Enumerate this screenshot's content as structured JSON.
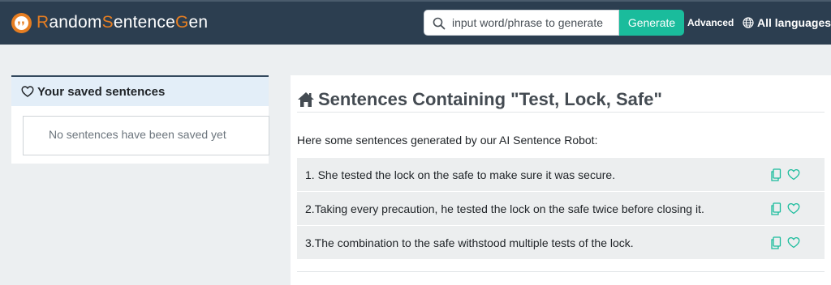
{
  "header": {
    "logo_parts": [
      "R",
      "andom",
      "S",
      "entence",
      "G",
      "en"
    ],
    "search_placeholder": "input word/phrase to generate",
    "generate_label": "Generate",
    "advanced_label": "Advanced",
    "languages_label": "All languages",
    "icons": [
      "logo-icon",
      "search-icon",
      "globe-icon"
    ]
  },
  "saved": {
    "title": "Your saved sentences",
    "empty_text": "No sentences have been saved yet",
    "icon": "heart-icon"
  },
  "main": {
    "title": "Sentences Containing \"Test, Lock, Safe\"",
    "title_icon": "home-icon",
    "intro": "Here some sentences generated by our AI Sentence Robot:",
    "sentences": [
      "1. She tested the lock on the safe to make sure it was secure.",
      "2.Taking every precaution, he tested the lock on the safe twice before closing it.",
      "3.The combination to the safe withstood multiple tests of the lock."
    ],
    "row_icons": [
      "copy-icon",
      "heart-icon"
    ]
  },
  "colors": {
    "header_bg": "#2c3e50",
    "brand_orange": "#e67e22",
    "accent_green": "#1abc9c",
    "page_bg": "#eceff1"
  }
}
